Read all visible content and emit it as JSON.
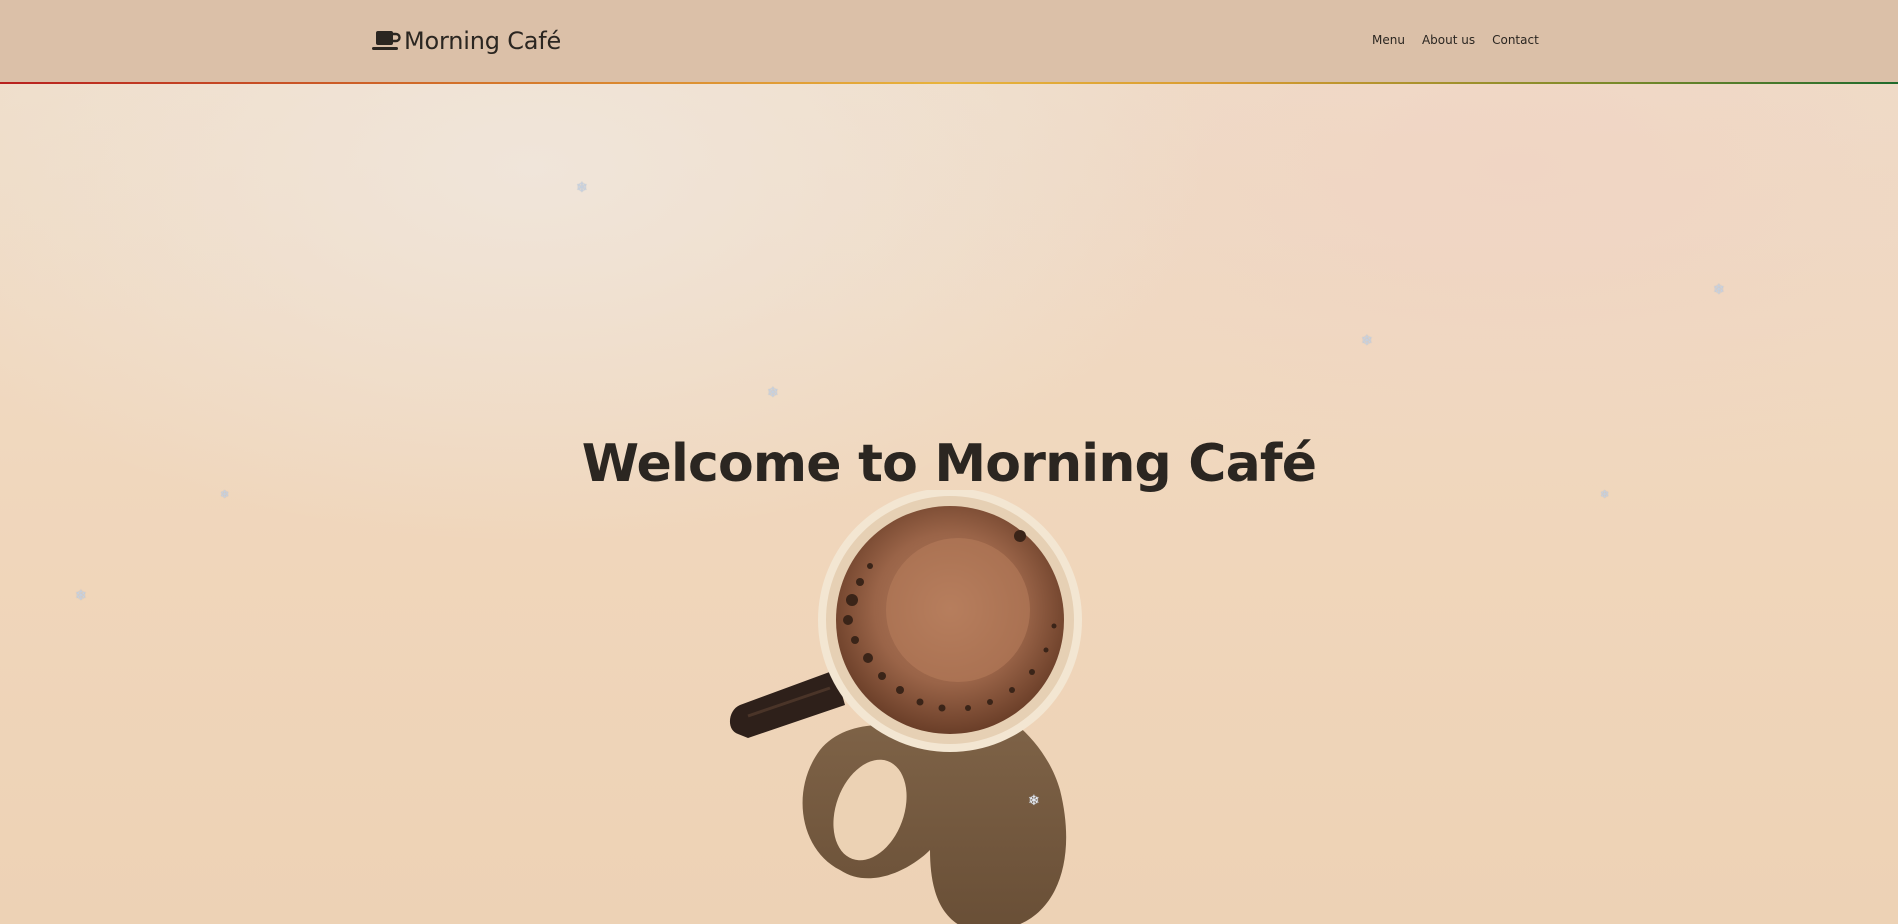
{
  "brand": {
    "name": "Morning Café",
    "icon": "coffee-cup-icon"
  },
  "nav": {
    "items": [
      "Menu",
      "About us",
      "Contact"
    ]
  },
  "hero": {
    "title": "Welcome to Morning Café",
    "image": "coffee-mug-top-view",
    "decoration_icon": "snowflake-icon"
  },
  "colors": {
    "header_bg": "#dbc0a8",
    "page_bg": "#f1dcc4",
    "text": "#2b2621",
    "accent_gradient": [
      "#b8201e",
      "#e8b43c",
      "#1f6a2c"
    ]
  }
}
